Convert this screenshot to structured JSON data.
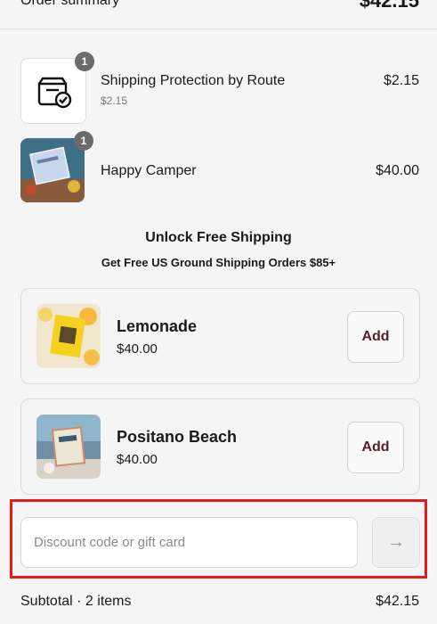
{
  "header": {
    "title": "Order summary",
    "total": "$42.15"
  },
  "cart_items": [
    {
      "name": "Shipping Protection by Route",
      "unit_price": "$2.15",
      "price": "$2.15",
      "qty": "1",
      "icon": "package-check-icon"
    },
    {
      "name": "Happy Camper",
      "price": "$40.00",
      "qty": "1"
    }
  ],
  "promo": {
    "title": "Unlock Free Shipping",
    "subtitle": "Get Free US Ground Shipping Orders $85+"
  },
  "upsells": [
    {
      "name": "Lemonade",
      "price": "$40.00",
      "button": "Add"
    },
    {
      "name": "Positano Beach",
      "price": "$40.00",
      "button": "Add"
    }
  ],
  "discount": {
    "placeholder": "Discount code or gift card",
    "value": "",
    "submit_icon": "arrow-right-icon"
  },
  "subtotal": {
    "label": "Subtotal · 2 items",
    "value": "$42.15"
  },
  "colors": {
    "highlight": "#e31b1b",
    "add_text": "#5a1f2a"
  }
}
